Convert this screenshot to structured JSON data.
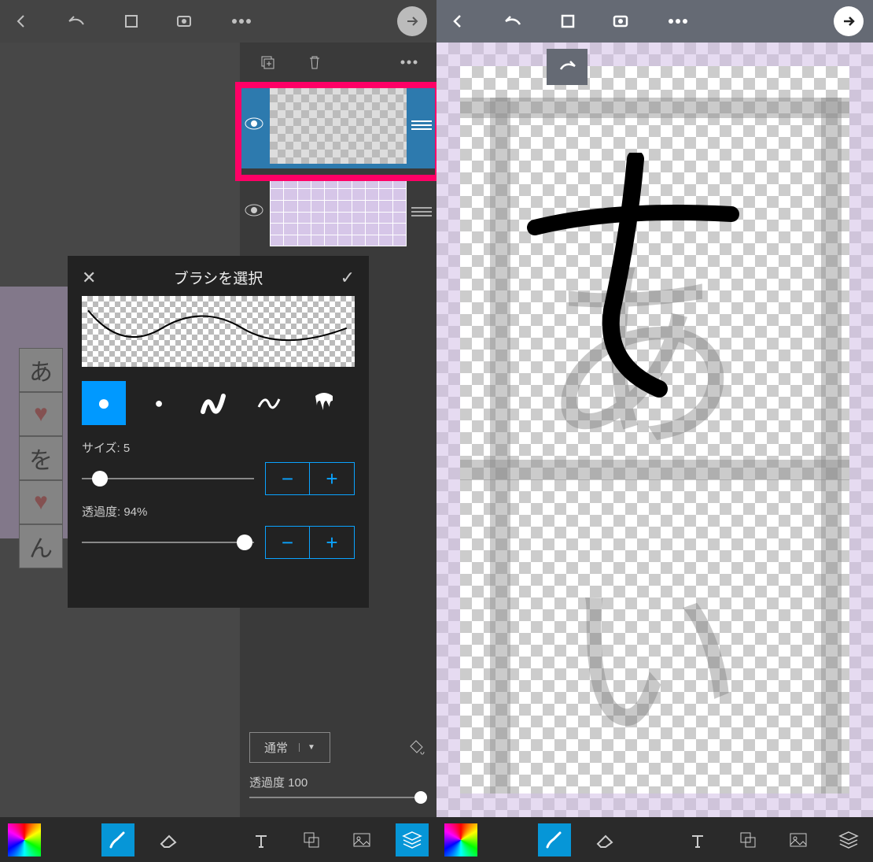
{
  "brush_popup": {
    "title": "ブラシを選択",
    "size_label": "サイズ: 5",
    "size_value": 5,
    "size_dot_pct": 6,
    "opacity_label": "透過度: 94%",
    "opacity_value": 94,
    "opacity_dot_pct": 90,
    "brush_icons": [
      "round",
      "soft",
      "scribble",
      "wave",
      "drip"
    ],
    "selected_brush": 0,
    "minus": "−",
    "plus": "+"
  },
  "layer_panel": {
    "blend_mode": "通常",
    "opacity_label": "透過度 100",
    "opacity_value": 100
  },
  "left_chars": [
    "あ",
    "♥",
    "を",
    "♥",
    "ん"
  ],
  "right_chars": {
    "top": "あ",
    "bottom": "い"
  }
}
